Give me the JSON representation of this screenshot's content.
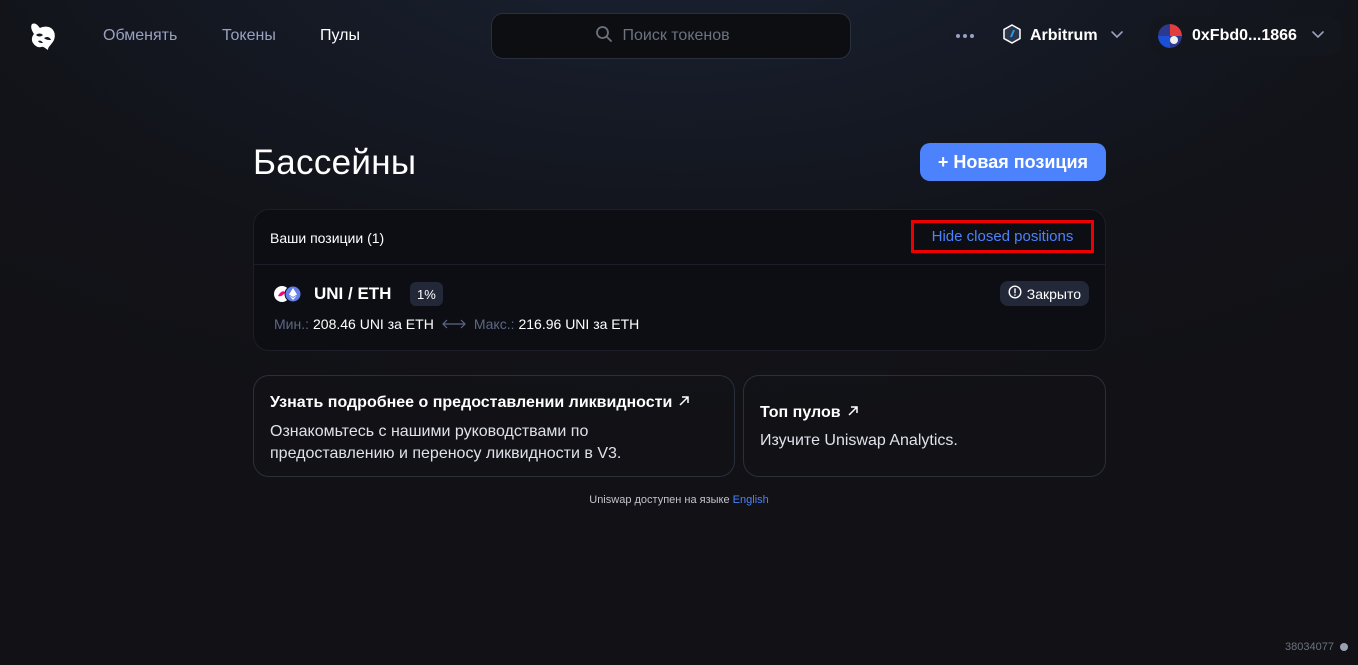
{
  "header": {
    "nav": [
      {
        "label": "Обменять",
        "active": false
      },
      {
        "label": "Токены",
        "active": false
      },
      {
        "label": "Пулы",
        "active": true
      }
    ],
    "search_placeholder": "Поиск токенов",
    "network": "Arbitrum",
    "wallet_address": "0xFbd0...1866"
  },
  "main": {
    "title": "Бассейны",
    "new_position_label": "+ Новая позиция",
    "positions": {
      "count_label": "Ваши позиции (1)",
      "hide_closed_label": "Hide closed positions",
      "items": [
        {
          "pair": "UNI / ETH",
          "fee": "1%",
          "status": "Закрыто",
          "min_label": "Мин.:",
          "min_value": "208.46 UNI за ETH",
          "max_label": "Макс.:",
          "max_value": "216.96 UNI за ETH"
        }
      ]
    },
    "cards": [
      {
        "title": "Узнать подробнее о предоставлении ликвидности",
        "text_line1": "Ознакомьтесь с нашими руководствами по",
        "text_line2": "предоставлению и переносу ликвидности в V3."
      },
      {
        "title": "Топ пулов",
        "text_line1": "Изучите Uniswap Analytics."
      }
    ],
    "language": {
      "prefix": "Uniswap доступен на языке",
      "link": "English"
    }
  },
  "footer": {
    "build": "38034077"
  },
  "colors": {
    "accent": "#4c82fb",
    "highlight_border": "#ee0000",
    "muted": "#98a1c0"
  }
}
